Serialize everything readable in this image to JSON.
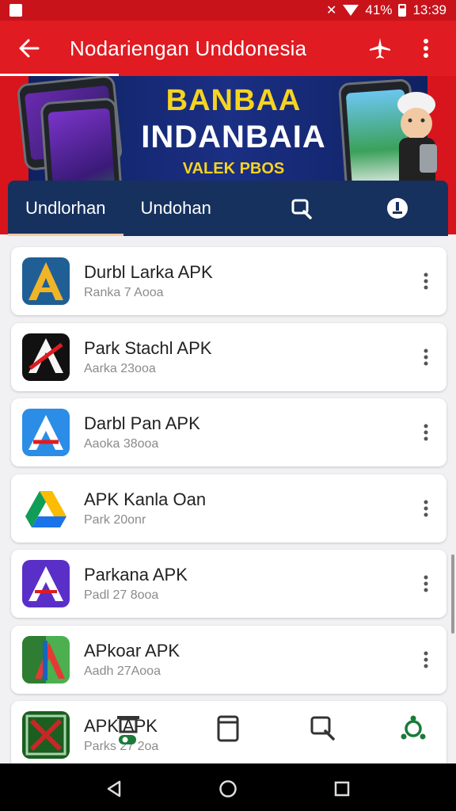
{
  "status_bar": {
    "time": "13:39",
    "signal_text": "41%"
  },
  "app_bar": {
    "title": "Nodariengan Unddonesia"
  },
  "banner": {
    "line1": "BANBAA",
    "line2": "INDANBAIA",
    "line3": "VALEK PBOS"
  },
  "tabs": [
    {
      "label": "Undlorhan"
    },
    {
      "label": "Undohan"
    }
  ],
  "apps": [
    {
      "name": "Durbl Larka APK",
      "sub": "Ranka 7 Aooa",
      "icon": "a-logo-yellow-blue-icon",
      "bg": "#1f5f95",
      "fg": "#f0b427"
    },
    {
      "name": "Park Stachl APK",
      "sub": "Aarka 23ooa",
      "icon": "a-logo-black-red-icon",
      "bg": "#111111",
      "fg": "#e01b22"
    },
    {
      "name": "Darbl Pan APK",
      "sub": "Aaoka 38ooa",
      "icon": "a-logo-blue-icon",
      "bg": "#2c8de6",
      "fg": "#ffffff"
    },
    {
      "name": "APK Kanla Oan",
      "sub": "Park 20onr",
      "icon": "drive-triangle-icon",
      "bg": "#ffffff",
      "fg": "#1a73e8"
    },
    {
      "name": "Parkana APK",
      "sub": "Padl 27 8ooa",
      "icon": "a-logo-purple-icon",
      "bg": "#5a2fc8",
      "fg": "#ffffff"
    },
    {
      "name": "APkoar APK",
      "sub": "Aadh 27Aooa",
      "icon": "a-logo-green-red-icon",
      "bg": "#2e7d32",
      "fg": "#e53935"
    },
    {
      "name": "APK APK",
      "sub": "Parks 27 2oa",
      "icon": "crossed-swords-green-icon",
      "bg": "#1b5e20",
      "fg": "#c62828"
    }
  ],
  "colors": {
    "primary_red": "#e01b22",
    "tab_navy": "#16315e",
    "banner_gold": "#f6d41f",
    "nav_active": "#1b7a3a"
  }
}
